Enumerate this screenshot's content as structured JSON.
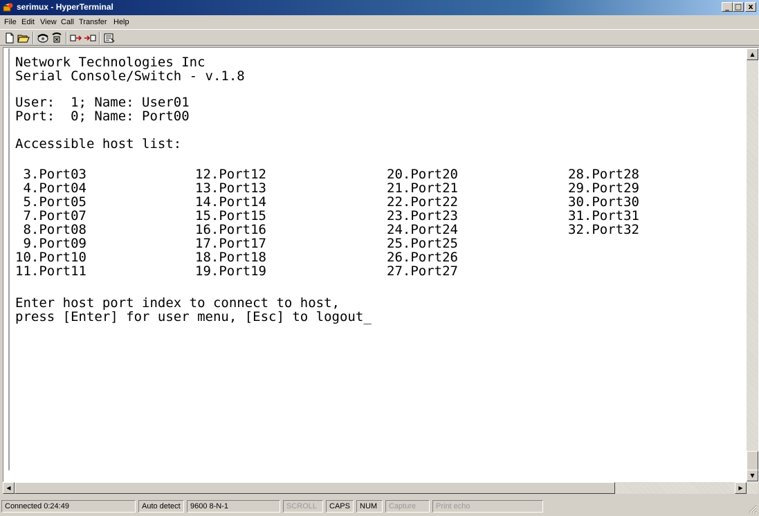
{
  "window": {
    "title": "serimux - HyperTerminal",
    "minimize": "_",
    "maximize": "□",
    "close": "x"
  },
  "menu": [
    "File",
    "Edit",
    "View",
    "Call",
    "Transfer",
    "Help"
  ],
  "toolbar": [
    "new-connection-icon",
    "open-icon",
    "phone-icon",
    "disconnect-icon",
    "send-icon",
    "receive-icon",
    "properties-icon"
  ],
  "terminal": {
    "lines": [
      "Network Technologies Inc",
      "Serial Console/Switch - v.1.8",
      "User:  1; Name: User01",
      "Port:  0; Name: Port00",
      "Accessible host list:"
    ],
    "ports": [
      [
        " 3.Port03",
        " 4.Port04",
        " 5.Port05",
        " 7.Port07",
        " 8.Port08",
        " 9.Port09",
        "10.Port10",
        "11.Port11"
      ],
      [
        "12.Port12",
        "13.Port13",
        "14.Port14",
        "15.Port15",
        "16.Port16",
        "17.Port17",
        "18.Port18",
        "19.Port19"
      ],
      [
        "20.Port20",
        "21.Port21",
        "22.Port22",
        "23.Port23",
        "24.Port24",
        "25.Port25",
        "26.Port26",
        "27.Port27"
      ],
      [
        "28.Port28",
        "29.Port29",
        "30.Port30",
        "31.Port31",
        "32.Port32"
      ]
    ],
    "prompt1": "Enter host port index to connect to host,",
    "prompt2": "press [Enter] for user menu, [Esc] to logout_"
  },
  "status": {
    "connected": "Connected 0:24:49",
    "detect": "Auto detect",
    "settings": "9600 8-N-1",
    "scroll": "SCROLL",
    "caps": "CAPS",
    "num": "NUM",
    "capture": "Capture",
    "print_echo": "Print echo"
  },
  "scrollbar": {
    "up": "▲",
    "down": "▼",
    "left": "◀",
    "right": "▶"
  }
}
